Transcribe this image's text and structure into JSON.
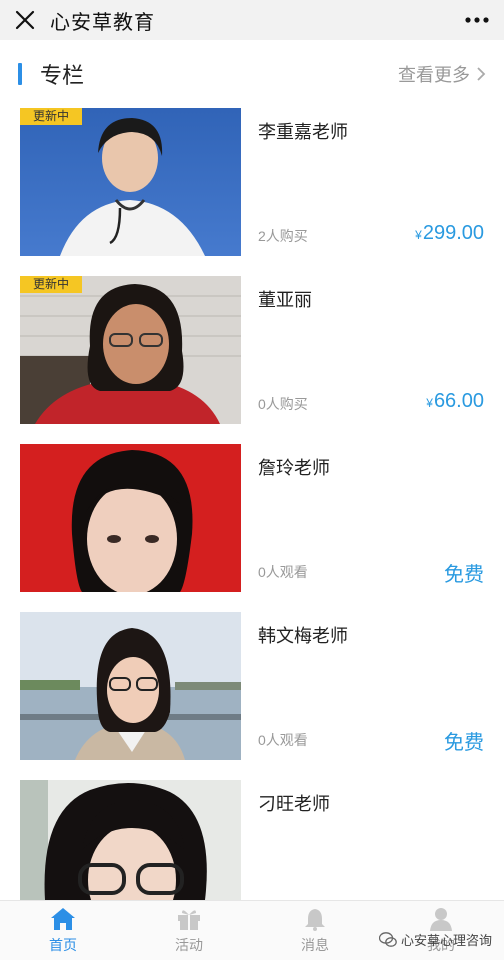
{
  "topbar": {
    "title": "心安草教育",
    "close_icon": "close-icon",
    "more_icon": "more-dots-icon"
  },
  "section": {
    "title": "专栏",
    "view_more": "查看更多"
  },
  "columns": [
    {
      "badge": "更新中",
      "name": "李重嘉老师",
      "count": "2人购买",
      "price_symbol": "¥",
      "price": "299.00"
    },
    {
      "badge": "更新中",
      "name": "董亚丽",
      "count": "0人购买",
      "price_symbol": "¥",
      "price": "66.00"
    },
    {
      "name": "詹玲老师",
      "count": "0人观看",
      "free": "免费"
    },
    {
      "name": "韩文梅老师",
      "count": "0人观看",
      "free": "免费"
    },
    {
      "name": "刁旺老师"
    }
  ],
  "tabs": [
    {
      "label": "首页",
      "icon": "home-icon",
      "active": true
    },
    {
      "label": "活动",
      "icon": "gift-icon"
    },
    {
      "label": "消息",
      "icon": "bell-icon"
    },
    {
      "label": "我的",
      "icon": "user-icon"
    }
  ],
  "watermark": {
    "text": "心安草心理咨询"
  },
  "colors": {
    "accent": "#2c8fe6",
    "price": "#2a9ae0",
    "badge": "#f5c623"
  }
}
